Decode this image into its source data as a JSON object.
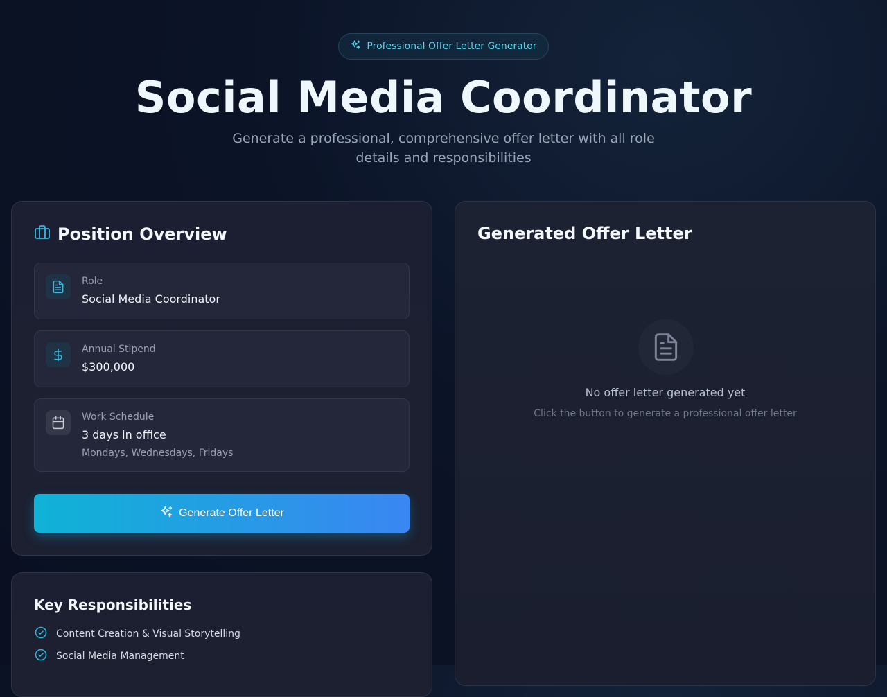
{
  "header": {
    "badge": "Professional Offer Letter Generator",
    "title": "Social Media Coordinator",
    "subtitle": "Generate a professional, comprehensive offer letter with all role details and responsibilities"
  },
  "overview": {
    "title": "Position Overview",
    "role": {
      "label": "Role",
      "value": "Social Media Coordinator",
      "icon": "document-icon"
    },
    "stipend": {
      "label": "Annual Stipend",
      "value": "$300,000",
      "icon": "dollar-icon"
    },
    "schedule": {
      "label": "Work Schedule",
      "value": "3 days in office",
      "detail": "Mondays, Wednesdays, Fridays",
      "icon": "calendar-icon"
    },
    "generate_button": "Generate Offer Letter"
  },
  "responsibilities": {
    "title": "Key Responsibilities",
    "items": [
      "Content Creation & Visual Storytelling",
      "Social Media Management"
    ]
  },
  "letter": {
    "title": "Generated Offer Letter",
    "empty_title": "No offer letter generated yet",
    "empty_subtitle": "Click the button to generate a professional offer letter"
  },
  "colors": {
    "accent": "#0fb3d6",
    "accent_end": "#3a86f2",
    "background": "#0b1326",
    "card": "#1b1f31"
  }
}
